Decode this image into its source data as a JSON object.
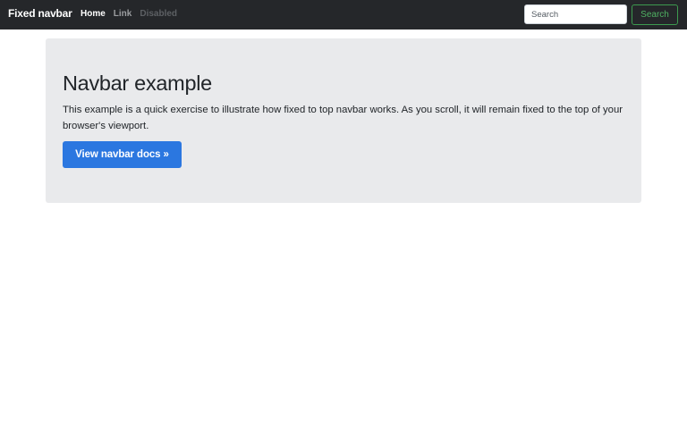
{
  "navbar": {
    "brand": "Fixed navbar",
    "links": [
      {
        "label": "Home",
        "state": "active"
      },
      {
        "label": "Link",
        "state": "normal"
      },
      {
        "label": "Disabled",
        "state": "disabled"
      }
    ],
    "search": {
      "placeholder": "Search",
      "value": "",
      "button_label": "Search"
    }
  },
  "jumbotron": {
    "title": "Navbar example",
    "text": "This example is a quick exercise to illustrate how fixed to top navbar works. As you scroll, it will remain fixed to the top of your browser's viewport.",
    "button_label": "View navbar docs »"
  },
  "colors": {
    "navbar_bg": "#25272a",
    "jumbotron_bg": "#e9eaec",
    "primary": "#2b77e0",
    "success": "#4fb162"
  }
}
